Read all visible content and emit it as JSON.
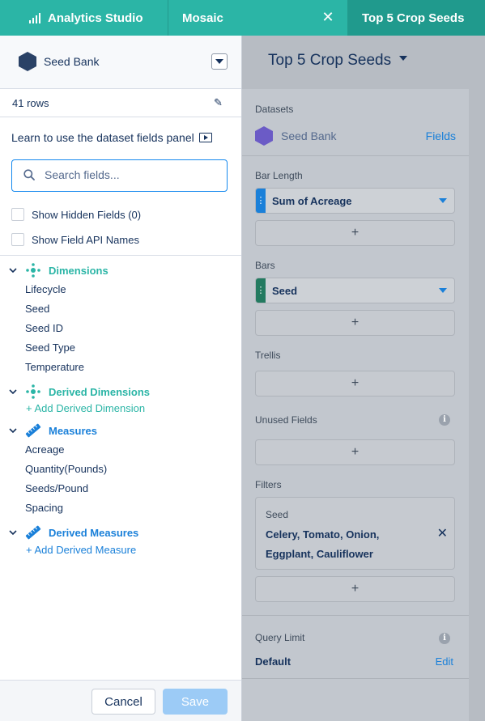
{
  "tabs": {
    "app_label": "Analytics Studio",
    "mosaic_label": "Mosaic",
    "active_label": "Top 5 Crop Seeds"
  },
  "colors": {
    "teal": "#2bb5a6",
    "blue": "#1a80d9",
    "purple_hex": "#6b5bc6",
    "navy_hex": "#2a4266"
  },
  "left_panel": {
    "dataset_name": "Seed Bank",
    "rows_text": "41 rows",
    "learn_text": "Learn to use the dataset fields panel",
    "search_placeholder": "Search fields...",
    "show_hidden": "Show Hidden Fields (0)",
    "show_api": "Show Field API Names",
    "dimensions": {
      "title": "Dimensions",
      "items": [
        "Lifecycle",
        "Seed",
        "Seed ID",
        "Seed Type",
        "Temperature"
      ]
    },
    "derived_dimensions": {
      "title": "Derived Dimensions",
      "add_label": "+ Add Derived Dimension"
    },
    "measures": {
      "title": "Measures",
      "items": [
        "Acreage",
        "Quantity(Pounds)",
        "Seeds/Pound",
        "Spacing"
      ]
    },
    "derived_measures": {
      "title": "Derived Measures",
      "add_label": "+ Add Derived Measure"
    },
    "cancel_label": "Cancel",
    "save_label": "Save"
  },
  "right_panel": {
    "title": "Top 5 Crop Seeds",
    "datasets_label": "Datasets",
    "dataset_name": "Seed Bank",
    "fields_link": "Fields",
    "bar_length_label": "Bar Length",
    "bar_length_value": "Sum of Acreage",
    "bars_label": "Bars",
    "bars_value": "Seed",
    "trellis_label": "Trellis",
    "unused_fields_label": "Unused Fields",
    "filters_label": "Filters",
    "filter_name": "Seed",
    "filter_values": "Celery, Tomato, Onion, Eggplant, Cauliflower",
    "query_limit_label": "Query Limit",
    "query_limit_value": "Default",
    "edit_label": "Edit",
    "add_symbol": "+"
  }
}
